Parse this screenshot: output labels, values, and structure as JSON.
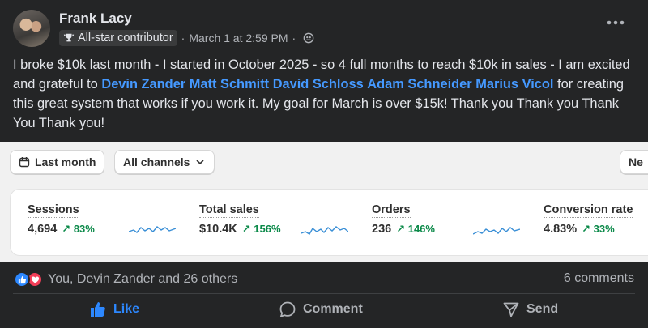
{
  "post": {
    "author": "Frank Lacy",
    "badge": "All-star contributor",
    "timestamp": "March 1 at 2:59 PM",
    "audience_icon": "globe-icon",
    "text_1": "I broke $10k last month - I started in October 2025 - so 4 full months to reach $10k in sales - I am excited and grateful to ",
    "mentions": [
      "Devin Zander",
      "Matt Schmitt",
      "David Schloss",
      "Adam Schneider",
      "Marius Vicol"
    ],
    "text_2": " for creating this great system that works if you work it.  My goal for March is over $15k!  Thank you Thank you Thank You Thank you!"
  },
  "embed": {
    "date_filter": "Last month",
    "channel_filter": "All channels",
    "extra_button": "Ne",
    "metrics": [
      {
        "label": "Sessions",
        "value": "4,694",
        "delta": "83%"
      },
      {
        "label": "Total sales",
        "value": "$10.4K",
        "delta": "156%"
      },
      {
        "label": "Orders",
        "value": "236",
        "delta": "146%"
      },
      {
        "label": "Conversion rate",
        "value": "4.83%",
        "delta": "33%"
      }
    ]
  },
  "footer": {
    "reactions_text": "You, Devin Zander and 26 others",
    "comments_text": "6 comments",
    "like_label": "Like",
    "comment_label": "Comment",
    "send_label": "Send"
  },
  "colors": {
    "background": "#242526",
    "mention": "#4599ff",
    "like_blue": "#2d88ff",
    "love_red": "#f33e58",
    "delta_green": "#0c8a4a"
  }
}
